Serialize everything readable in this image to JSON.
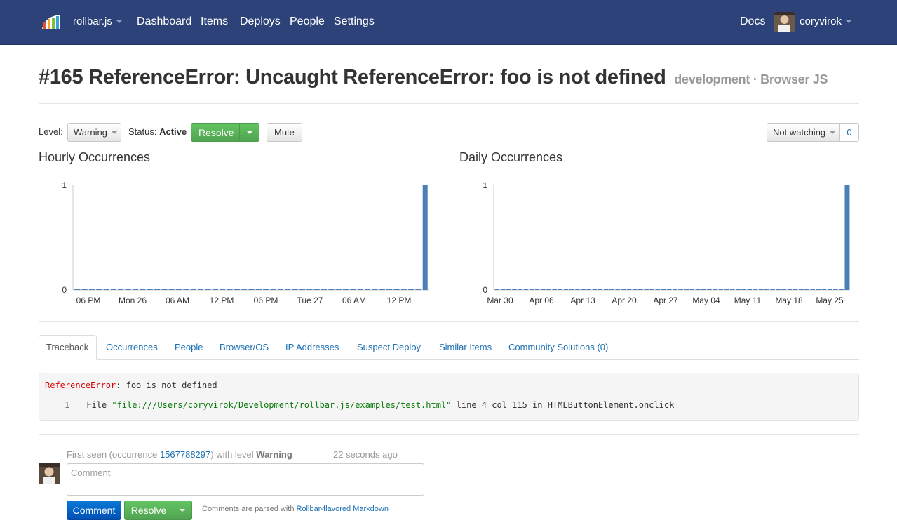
{
  "nav": {
    "project": "rollbar.js",
    "links": [
      "Dashboard",
      "Items",
      "Deploys",
      "People",
      "Settings"
    ],
    "docs": "Docs",
    "user": "coryvirok",
    "logo_icon": "rollbar-logo-icon",
    "bg_color": "#2c4278"
  },
  "item": {
    "title": "#165 ReferenceError: Uncaught ReferenceError: foo is not defined",
    "environment": "development",
    "separator": "·",
    "platform": "Browser JS"
  },
  "controls": {
    "level_label": "Level:",
    "level_value": "Warning",
    "status_label": "Status:",
    "status_value": "Active",
    "resolve_label": "Resolve",
    "mute_label": "Mute",
    "watch_label": "Not watching",
    "watch_count": "0"
  },
  "chart_data": [
    {
      "type": "bar",
      "title": "Hourly Occurrences",
      "x_tick_labels": [
        "06 PM",
        "Mon 26",
        "06 AM",
        "12 PM",
        "06 PM",
        "Tue 27",
        "06 AM",
        "12 PM"
      ],
      "y_tick_labels": [
        "0",
        "1"
      ],
      "ylim": [
        0,
        1
      ],
      "bar_count": 49,
      "values_note_last_bar": 1,
      "values": [
        0,
        0,
        0,
        0,
        0,
        0,
        0,
        0,
        0,
        0,
        0,
        0,
        0,
        0,
        0,
        0,
        0,
        0,
        0,
        0,
        0,
        0,
        0,
        0,
        0,
        0,
        0,
        0,
        0,
        0,
        0,
        0,
        0,
        0,
        0,
        0,
        0,
        0,
        0,
        0,
        0,
        0,
        0,
        0,
        0,
        0,
        0,
        0,
        1
      ],
      "color": "#4a7fb8",
      "grid": false
    },
    {
      "type": "bar",
      "title": "Daily Occurrences",
      "x_tick_labels": [
        "Mar 30",
        "Apr 06",
        "Apr 13",
        "Apr 20",
        "Apr 27",
        "May 04",
        "May 11",
        "May 18",
        "May 25"
      ],
      "y_tick_labels": [
        "0",
        "1"
      ],
      "ylim": [
        0,
        1
      ],
      "values": [
        0,
        0,
        0,
        0,
        0,
        0,
        0,
        0,
        0,
        0,
        0,
        0,
        0,
        0,
        0,
        0,
        0,
        0,
        0,
        0,
        0,
        0,
        0,
        0,
        0,
        0,
        0,
        0,
        0,
        0,
        0,
        0,
        0,
        0,
        0,
        0,
        0,
        0,
        0,
        0,
        0,
        0,
        0,
        0,
        0,
        0,
        0,
        0,
        0,
        0,
        0,
        0,
        0,
        0,
        0,
        0,
        0,
        0,
        0,
        0,
        0,
        1
      ],
      "color": "#4a7fb8",
      "grid": false
    }
  ],
  "tabs": [
    "Traceback",
    "Occurrences",
    "People",
    "Browser/OS",
    "IP Addresses",
    "Suspect Deploy",
    "Similar Items",
    "Community Solutions (0)"
  ],
  "traceback": {
    "error_type": "ReferenceError",
    "error_message": ": foo is not defined",
    "frame_number": "1",
    "frame_prefix": "File ",
    "frame_file": "\"file:///Users/coryvirok/Development/rollbar.js/examples/test.html\"",
    "frame_suffix": " line 4 col 115 in HTMLButtonElement.onclick"
  },
  "comment": {
    "first_seen_prefix": "First seen (occurrence ",
    "occurrence_id": "1567788297",
    "first_seen_mid": ") with level ",
    "level": "Warning",
    "time_ago": "22 seconds ago",
    "placeholder": "Comment",
    "submit_label": "Comment",
    "resolve_label": "Resolve",
    "hint_prefix": "Comments are parsed with ",
    "hint_link": "Rollbar-flavored Markdown"
  }
}
